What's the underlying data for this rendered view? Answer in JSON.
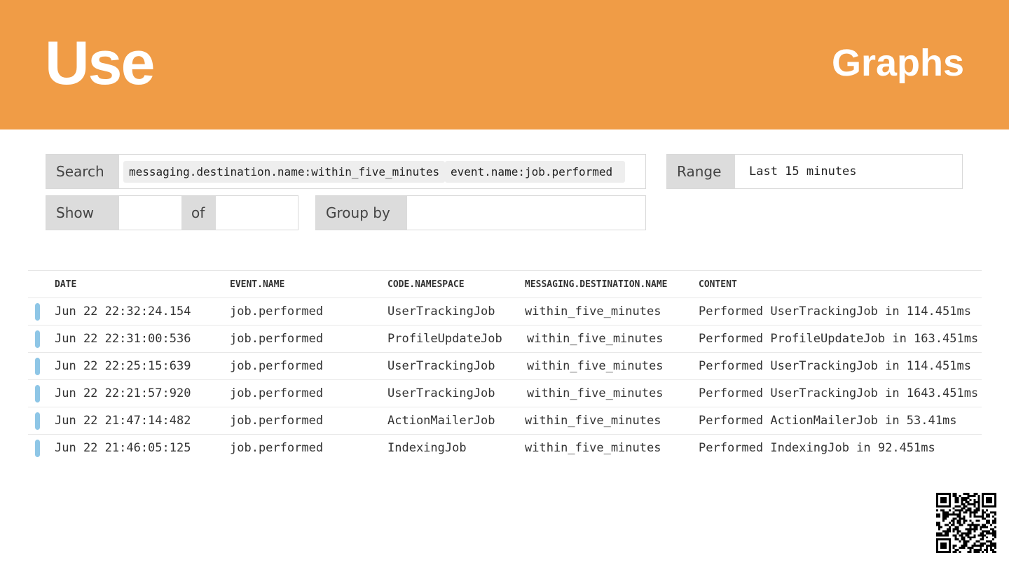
{
  "slide": {
    "title": "Use",
    "section": "Graphs"
  },
  "search": {
    "label": "Search",
    "chips": [
      "messaging.destination.name:within_five_minutes",
      "event.name:job.performed"
    ]
  },
  "range": {
    "label": "Range",
    "value": "Last 15 minutes"
  },
  "show": {
    "label": "Show",
    "value": "",
    "of_label": "of",
    "of_value": ""
  },
  "group_by": {
    "label": "Group by",
    "value": ""
  },
  "table": {
    "columns": [
      "DATE",
      "EVENT.NAME",
      "CODE.NAMESPACE",
      "MESSAGING.DESTINATION.NAME",
      "CONTENT"
    ],
    "rows": [
      [
        "Jun 22 22:32:24.154",
        "job.performed",
        "UserTrackingJob",
        "within_five_minutes",
        "Performed UserTrackingJob in 114.451ms"
      ],
      [
        "Jun 22 22:31:00:536",
        "job.performed",
        "ProfileUpdateJob",
        "within_five_minutes",
        "Performed ProfileUpdateJob in 163.451ms"
      ],
      [
        "Jun 22 22:25:15:639",
        "job.performed",
        "UserTrackingJob",
        "within_five_minutes",
        "Performed UserTrackingJob in 114.451ms"
      ],
      [
        "Jun 22 22:21:57:920",
        "job.performed",
        "UserTrackingJob",
        "within_five_minutes",
        "Performed UserTrackingJob in 1643.451ms"
      ],
      [
        "Jun 22 21:47:14:482",
        "job.performed",
        "ActionMailerJob",
        "within_five_minutes",
        "Performed ActionMailerJob in 53.41ms"
      ],
      [
        "Jun 22 21:46:05:125",
        "job.performed",
        "IndexingJob",
        "within_five_minutes",
        "Performed IndexingJob in 92.451ms"
      ]
    ]
  },
  "colors": {
    "header": "#f09c46",
    "row_marker": "#8ec6e6",
    "label_bg": "#dcdcdc"
  },
  "icons": {
    "qr": "qr-code-icon"
  }
}
